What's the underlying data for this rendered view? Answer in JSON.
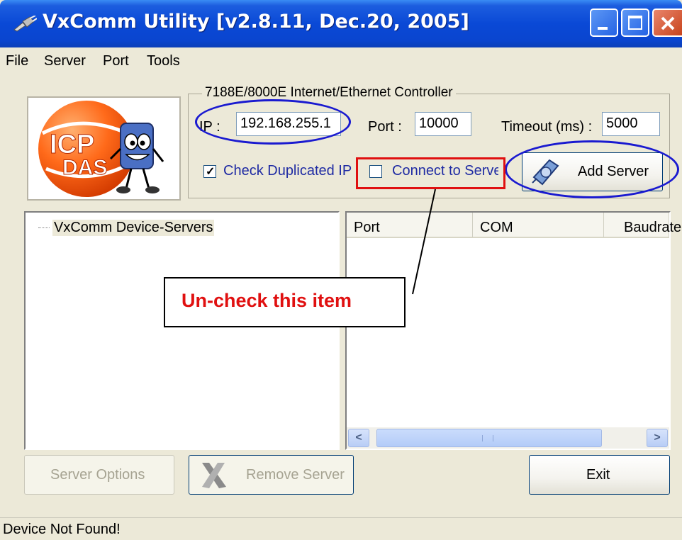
{
  "window": {
    "title": "VxComm Utility [v2.8.11, Dec.20, 2005]",
    "icon": "plug-icon",
    "controls": [
      "minimize-icon",
      "maximize-icon",
      "close-icon"
    ]
  },
  "menu": {
    "items": [
      "File",
      "Server",
      "Port",
      "Tools"
    ]
  },
  "logo": {
    "text": "ICP DAS"
  },
  "controller_group": {
    "legend": "7188E/8000E Internet/Ethernet Controller",
    "ip_label": "IP :",
    "ip_value": "192.168.255.1",
    "port_label": "Port :",
    "port_value": "10000",
    "timeout_label": "Timeout (ms) :",
    "timeout_value": "5000",
    "check_duplicated_label": "Check Duplicated IP",
    "check_duplicated_checked": true,
    "connect_label": "Connect to Serve",
    "connect_checked": false,
    "add_server_label": "Add Server"
  },
  "tree": {
    "root_label": "VxComm Device-Servers"
  },
  "list": {
    "columns": [
      "Port",
      "COM",
      "Baudrate"
    ]
  },
  "buttons": {
    "server_options": "Server Options",
    "remove_server": "Remove Server",
    "exit": "Exit"
  },
  "status": {
    "text": "Device Not Found!"
  },
  "annotation": {
    "callout_text": "Un-check this item",
    "ellipse_color": "#1a1ad0",
    "highlight_color": "#e01010"
  }
}
